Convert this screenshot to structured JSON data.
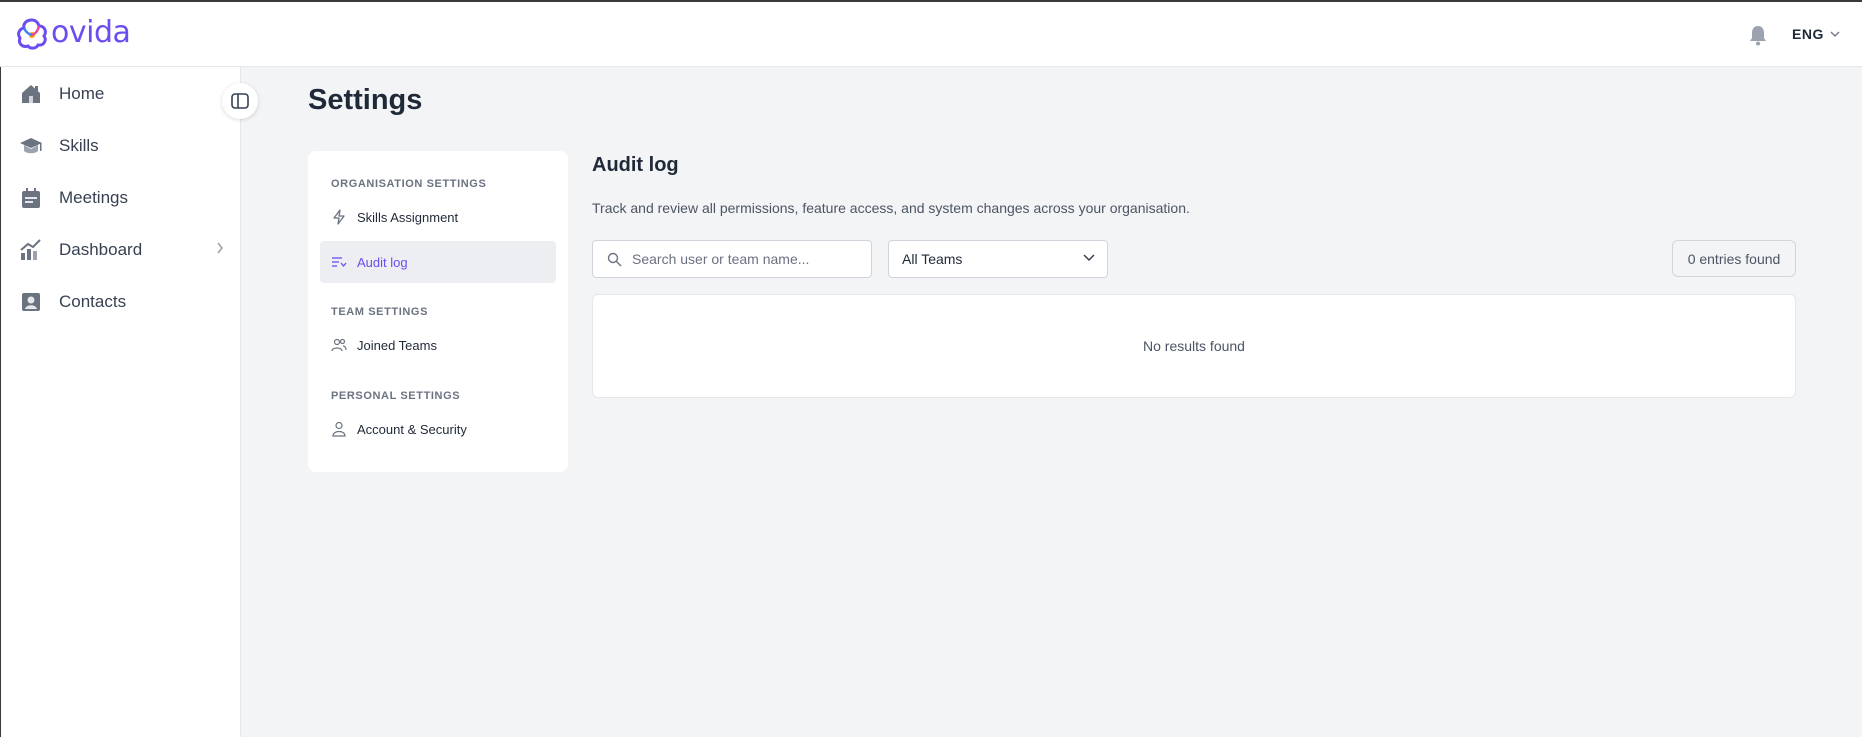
{
  "brand": {
    "name": "ovida",
    "color": "#6d4cf0"
  },
  "header": {
    "language": "ENG",
    "notification_icon": "bell-icon"
  },
  "sidebar": {
    "items": [
      {
        "label": "Home",
        "icon": "home-icon"
      },
      {
        "label": "Skills",
        "icon": "graduation-cap-icon"
      },
      {
        "label": "Meetings",
        "icon": "calendar-icon"
      },
      {
        "label": "Dashboard",
        "icon": "chart-icon",
        "has_submenu": true
      },
      {
        "label": "Contacts",
        "icon": "contact-card-icon"
      }
    ]
  },
  "page": {
    "title": "Settings"
  },
  "settings_nav": {
    "sections": [
      {
        "heading": "ORGANISATION SETTINGS",
        "items": [
          {
            "label": "Skills Assignment",
            "icon": "lightning-icon",
            "active": false
          },
          {
            "label": "Audit log",
            "icon": "list-filter-icon",
            "active": true
          }
        ]
      },
      {
        "heading": "TEAM SETTINGS",
        "items": [
          {
            "label": "Joined Teams",
            "icon": "users-icon",
            "active": false
          }
        ]
      },
      {
        "heading": "PERSONAL SETTINGS",
        "items": [
          {
            "label": "Account & Security",
            "icon": "user-icon",
            "active": false
          }
        ]
      }
    ]
  },
  "audit": {
    "title": "Audit log",
    "description": "Track and review all permissions, feature access, and system changes across your organisation.",
    "search_placeholder": "Search user or team name...",
    "search_value": "",
    "team_filter": "All Teams",
    "entries_count": "0 entries found",
    "empty_message": "No results found"
  }
}
